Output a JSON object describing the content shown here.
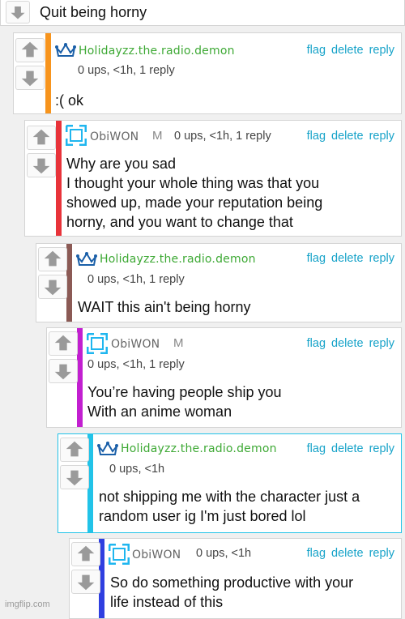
{
  "top_comment": {
    "text": "Quit being horny"
  },
  "comments": [
    {
      "username": "Holidayzz.the.radio.demon",
      "meta": "0 ups, <1h, 1 reply",
      "text": ":( ok",
      "bar_color": "#f7941d",
      "avatar": "crown-icon",
      "actions": [
        "flag",
        "delete",
        "reply"
      ]
    },
    {
      "username": "ObiWON",
      "badge": "M",
      "meta": "0 ups, <1h, 1 reply",
      "text": "Why are you sad\nI thought your whole thing was that you\nshowed up, made your reputation being\nhorny, and you want to change that",
      "bar_color": "#e8333a",
      "avatar": "square-avatar-icon",
      "actions": [
        "flag",
        "delete",
        "reply"
      ]
    },
    {
      "username": "Holidayzz.the.radio.demon",
      "meta": "0 ups, <1h, 1 reply",
      "text": "WAIT this ain't being horny",
      "bar_color": "#8b5a55",
      "avatar": "crown-icon",
      "actions": [
        "flag",
        "delete",
        "reply"
      ]
    },
    {
      "username": "ObiWON",
      "badge": "M",
      "meta": "0 ups, <1h, 1 reply",
      "text": "You’re having people ship you\nWith an anime woman",
      "bar_color": "#c21fd0",
      "avatar": "square-avatar-icon",
      "actions": [
        "flag",
        "delete",
        "reply"
      ]
    },
    {
      "username": "Holidayzz.the.radio.demon",
      "meta": "0 ups, <1h",
      "text": "not shipping me with the character just a\nrandom user ig I'm just bored lol",
      "bar_color": "#22c3e8",
      "avatar": "crown-icon",
      "actions": [
        "flag",
        "delete",
        "reply"
      ]
    },
    {
      "username": "ObiWON",
      "meta": "0 ups, <1h",
      "text": "So do something productive with your\nlife instead of this",
      "bar_color": "#2f3fe0",
      "avatar": "square-avatar-icon",
      "actions": [
        "flag",
        "delete",
        "reply"
      ]
    }
  ],
  "watermark": "imgflip.com"
}
